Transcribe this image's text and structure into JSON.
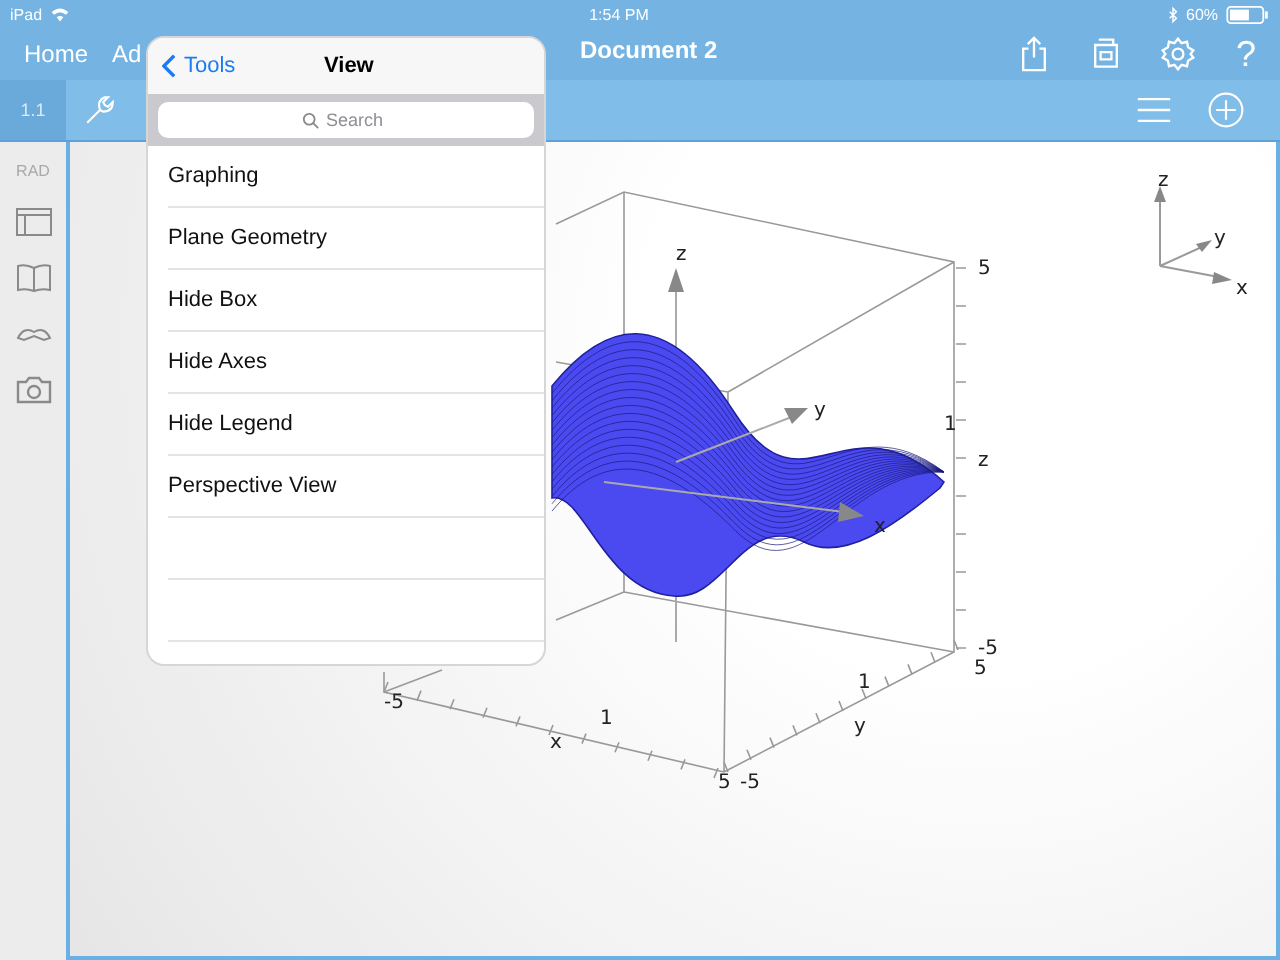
{
  "status_bar": {
    "device": "iPad",
    "time": "1:54 PM",
    "battery": "60%"
  },
  "nav_bar": {
    "items": [
      "Home",
      "Ad"
    ],
    "title": "Document 2",
    "help": "?"
  },
  "toolbar": {
    "page_tab": "1.1"
  },
  "sidebar": {
    "mode": "RAD"
  },
  "popover": {
    "back": "Tools",
    "title": "View",
    "search": {
      "placeholder": "Search"
    },
    "items": [
      {
        "label": "Graphing"
      },
      {
        "label": "Plane Geometry"
      },
      {
        "label": "Hide Box"
      },
      {
        "label": "Hide Axes"
      },
      {
        "label": "Hide Legend"
      },
      {
        "label": "Perspective View"
      }
    ]
  },
  "graph": {
    "labels": [
      "z",
      "y",
      "x",
      "5",
      "1",
      "z",
      "-5",
      "5",
      "1",
      "y",
      "5",
      "-5",
      "-5",
      "1",
      "x"
    ],
    "triad": [
      "z",
      "y",
      "x"
    ]
  }
}
